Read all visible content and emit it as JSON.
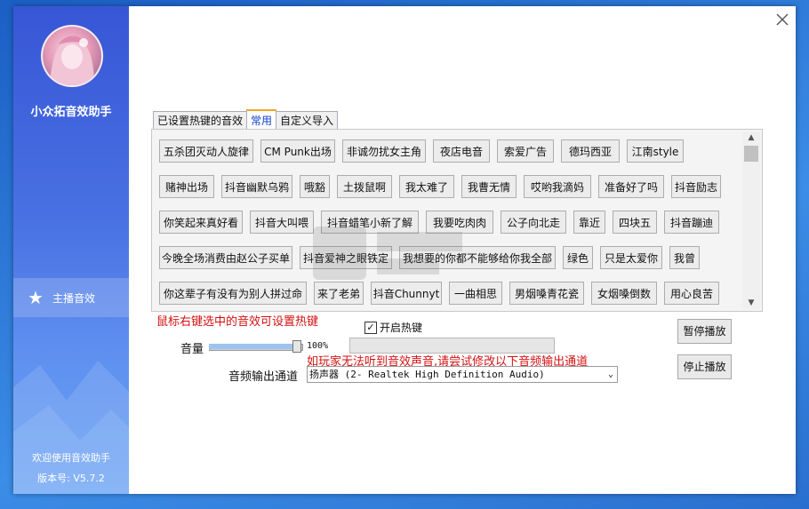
{
  "app": {
    "name": "小众拓音效助手",
    "welcome": "欢迎使用音效助手",
    "version": "版本号: V5.7.2"
  },
  "sidebar": {
    "items": [
      {
        "label": "主播音效",
        "icon": "star-icon"
      }
    ]
  },
  "tabs": [
    {
      "label": "已设置热键的音效",
      "active": false
    },
    {
      "label": "常用",
      "active": true
    },
    {
      "label": "自定义导入",
      "active": false
    }
  ],
  "sounds": [
    [
      "五杀团灭动人旋律",
      "CM Punk出场",
      "非诚勿扰女主角",
      "夜店电音",
      "索爱广告",
      "德玛西亚",
      "江南style"
    ],
    [
      "赌神出场",
      "抖音幽默乌鸦",
      "哦豁",
      "土拨鼠啊",
      "我太难了",
      "我曹无情",
      "哎哟我滴妈",
      "准备好了吗",
      "抖音励志"
    ],
    [
      "你笑起来真好看",
      "抖音大叫喂",
      "抖音蜡笔小新了解",
      "我要吃肉肉",
      "公子向北走",
      "靠近",
      "四块五",
      "抖音蹦迪"
    ],
    [
      "今晚全场消费由赵公子买单",
      "抖音爱神之眼铁定",
      "我想要的你都不能够给你我全部",
      "绿色",
      "只是太爱你",
      "我曾"
    ],
    [
      "你这辈子有没有为别人拼过命",
      "来了老弟",
      "抖音Chunnyt",
      "一曲相思",
      "男烟嗓青花瓷",
      "女烟嗓倒数",
      "用心良苦"
    ]
  ],
  "hint": "鼠标右键选中的音效可设置热键",
  "hotkey": {
    "label": "开启热键",
    "checked": true
  },
  "volume": {
    "label": "音量",
    "value_text": "100%",
    "level": 1.0
  },
  "warning": "如玩家无法听到音效声音,请尝试修改以下音频输出通道",
  "output": {
    "label": "音频输出通道",
    "selected": "扬声器 (2- Realtek High Definition Audio)"
  },
  "buttons": {
    "pause": "暂停播放",
    "stop": "停止播放"
  },
  "colors": {
    "accent": "#3756d6",
    "warning": "#d41010",
    "tab_active": "#1340c8"
  }
}
